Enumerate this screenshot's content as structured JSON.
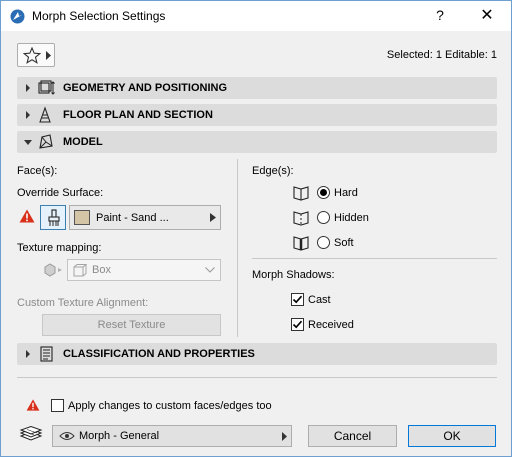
{
  "window": {
    "title": "Morph Selection Settings",
    "help": "?",
    "close": "✕"
  },
  "header": {
    "selected_info": "Selected: 1 Editable: 1"
  },
  "sections": {
    "geometry": "GEOMETRY AND POSITIONING",
    "floor_plan": "FLOOR PLAN AND SECTION",
    "model": "MODEL",
    "classification": "CLASSIFICATION AND PROPERTIES"
  },
  "model": {
    "faces_label": "Face(s):",
    "override_surface_label": "Override Surface:",
    "surface_value": "Paint - Sand ...",
    "surface_color": "#d3c5a6",
    "texture_mapping_label": "Texture mapping:",
    "texture_mapping_value": "Box",
    "custom_texture_label": "Custom Texture Alignment:",
    "reset_texture": "Reset Texture",
    "edges_label": "Edge(s):",
    "edge_options": [
      "Hard",
      "Hidden",
      "Soft"
    ],
    "edge_selected": "Hard",
    "shadows_label": "Morph Shadows:",
    "cast_label": "Cast",
    "cast_checked": true,
    "received_label": "Received",
    "received_checked": true
  },
  "footer": {
    "apply_label": "Apply changes to custom faces/edges too",
    "apply_checked": false,
    "view_dropdown": "Morph - General",
    "cancel": "Cancel",
    "ok": "OK"
  },
  "colors": {
    "accent": "#0078d7",
    "warning": "#d9301c",
    "section_bg": "#dcdcdc"
  }
}
